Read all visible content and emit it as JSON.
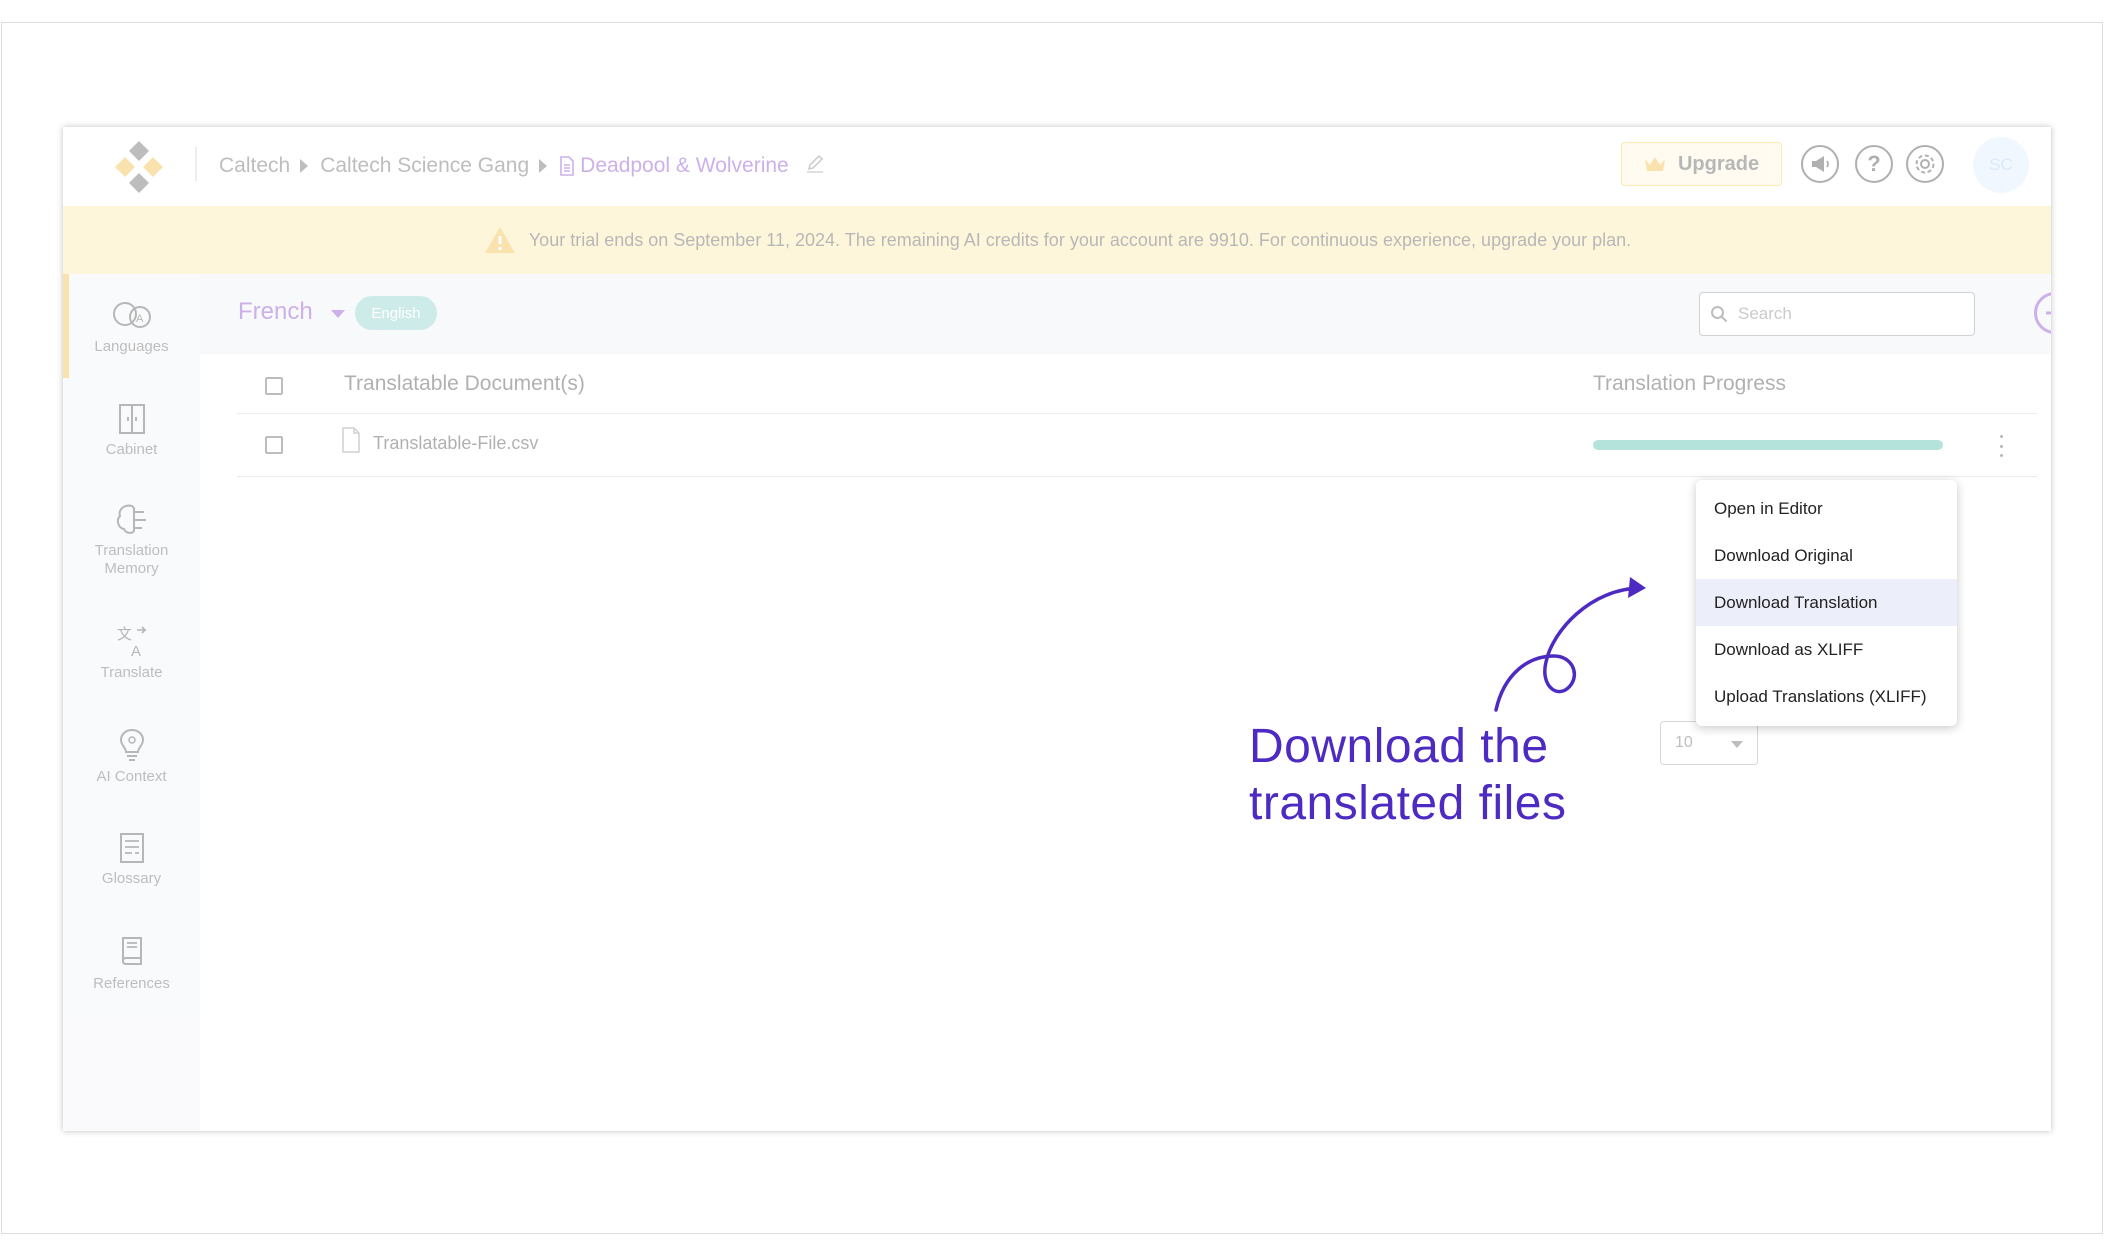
{
  "breadcrumb": {
    "org": "Caltech",
    "team": "Caltech Science Gang",
    "document": "Deadpool & Wolverine"
  },
  "header": {
    "upgrade_label": "Upgrade",
    "avatar_initials": "SC"
  },
  "banner": {
    "text": "Your trial ends on September 11, 2024. The remaining AI credits for your account are 9910. For continuous experience, upgrade your plan."
  },
  "sidebar": {
    "items": [
      {
        "label": "Languages",
        "icon": "languages-icon"
      },
      {
        "label": "Cabinet",
        "icon": "cabinet-icon"
      },
      {
        "label": "Translation\nMemory",
        "icon": "brain-icon"
      },
      {
        "label": "Translate",
        "icon": "translate-icon"
      },
      {
        "label": "AI Context",
        "icon": "lightbulb-icon"
      },
      {
        "label": "Glossary",
        "icon": "glossary-icon"
      },
      {
        "label": "References",
        "icon": "book-icon"
      }
    ]
  },
  "language_bar": {
    "target_language": "French",
    "source_language": "English",
    "search_placeholder": "Search"
  },
  "table": {
    "headers": [
      "Translatable Document(s)",
      "Translation Progress"
    ],
    "rows": [
      {
        "file": "Translatable-File.csv",
        "progress": 1.0
      }
    ],
    "page_size": "10"
  },
  "context_menu": {
    "items": [
      "Open in Editor",
      "Download Original",
      "Download Translation",
      "Download as XLIFF",
      "Upload Translations (XLIFF)"
    ],
    "highlighted": "Download Translation"
  },
  "annotation": {
    "line1": "Download the",
    "line2": "translated files"
  },
  "colors": {
    "brand_purple": "#7a33c8",
    "annotation_purple": "#4d2bc3",
    "banner_yellow": "#fde9a2",
    "progress_teal": "#3cb6a6",
    "accent_gold": "#f3b52c"
  }
}
